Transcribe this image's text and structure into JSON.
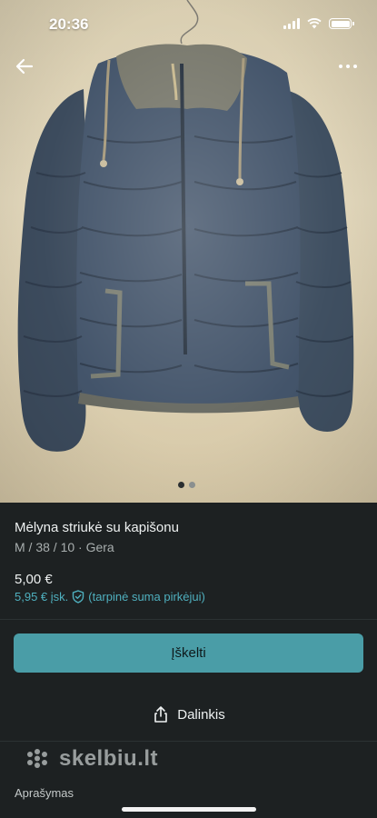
{
  "status_bar": {
    "time": "20:36"
  },
  "gallery": {
    "image_count": 2,
    "active_index": 0
  },
  "listing": {
    "title": "Mėlyna striukė su kapišonu",
    "meta": "M / 38 / 10 · Gera",
    "price": "5,00 €",
    "buyer_price": "5,95 € įsk.",
    "buyer_note": "(tarpinė suma pirkėjui)"
  },
  "actions": {
    "buy_label": "Įškelti",
    "share_label": "Dalinkis"
  },
  "watermark": {
    "text": "skelbiu.lt"
  },
  "sections": {
    "description_label": "Aprašymas"
  },
  "colors": {
    "background": "#1d2122",
    "accent": "#4a9da7",
    "accent_text": "#4fb0bf",
    "jacket": "#3f4e60"
  },
  "icons": [
    "back-arrow-icon",
    "more-icon",
    "shield-check-icon",
    "share-icon",
    "skelbiu-logo-icon"
  ]
}
